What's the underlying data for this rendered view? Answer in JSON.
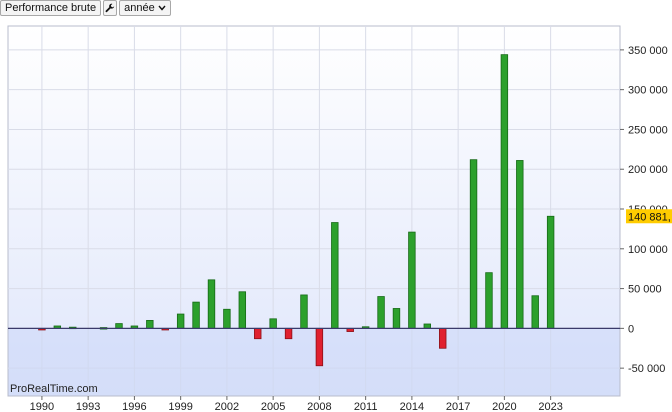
{
  "toolbar": {
    "perf_button_label": "Performance brute",
    "settings_icon": "wrench-icon",
    "period_select_value": "année",
    "dropdown_icon": "chevron-down-icon"
  },
  "watermark": "ProRealTime.com",
  "colors": {
    "positive": "#2ca02c",
    "negative": "#e0202e",
    "last_value_bg": "#ffcc00",
    "baseline": "#3a3a6a",
    "grid": "#d9dce8"
  },
  "chart_data": {
    "type": "bar",
    "title": "",
    "xlabel": "",
    "ylabel": "",
    "ylim": [
      -85000,
      380000
    ],
    "y_ticks": [
      {
        "value": 350000,
        "label": "350 000"
      },
      {
        "value": 300000,
        "label": "300 000"
      },
      {
        "value": 250000,
        "label": "250 000"
      },
      {
        "value": 200000,
        "label": "200 000"
      },
      {
        "value": 150000,
        "label": "150 000"
      },
      {
        "value": 100000,
        "label": "100 000"
      },
      {
        "value": 50000,
        "label": "50 000"
      },
      {
        "value": 0,
        "label": "0"
      },
      {
        "value": -50000,
        "label": "-50 000"
      }
    ],
    "x_ticks": [
      {
        "value": 1990,
        "label": "1990"
      },
      {
        "value": 1993,
        "label": "1993"
      },
      {
        "value": 1996,
        "label": "1996"
      },
      {
        "value": 1999,
        "label": "1999"
      },
      {
        "value": 2002,
        "label": "2002"
      },
      {
        "value": 2005,
        "label": "2005"
      },
      {
        "value": 2008,
        "label": "2008"
      },
      {
        "value": 2011,
        "label": "2011"
      },
      {
        "value": 2014,
        "label": "2014"
      },
      {
        "value": 2017,
        "label": "2017"
      },
      {
        "value": 2020,
        "label": "2020"
      },
      {
        "value": 2023,
        "label": "2023"
      }
    ],
    "x": [
      1990,
      1991,
      1992,
      1994,
      1995,
      1996,
      1997,
      1998,
      1999,
      2000,
      2001,
      2002,
      2003,
      2004,
      2005,
      2006,
      2007,
      2008,
      2009,
      2010,
      2011,
      2012,
      2013,
      2014,
      2015,
      2016,
      2018,
      2019,
      2020,
      2021,
      2022,
      2023
    ],
    "values": [
      -2000,
      3000,
      1500,
      1000,
      6000,
      3000,
      10000,
      -2000,
      18000,
      33000,
      61000,
      24000,
      46000,
      -13000,
      12000,
      -13000,
      42000,
      -47000,
      133000,
      -4000,
      2000,
      40000,
      25000,
      121000,
      5500,
      -25000,
      212000,
      70000,
      344000,
      211000,
      41000,
      140881
    ],
    "last_value_label": "140 881,",
    "grid": true
  }
}
